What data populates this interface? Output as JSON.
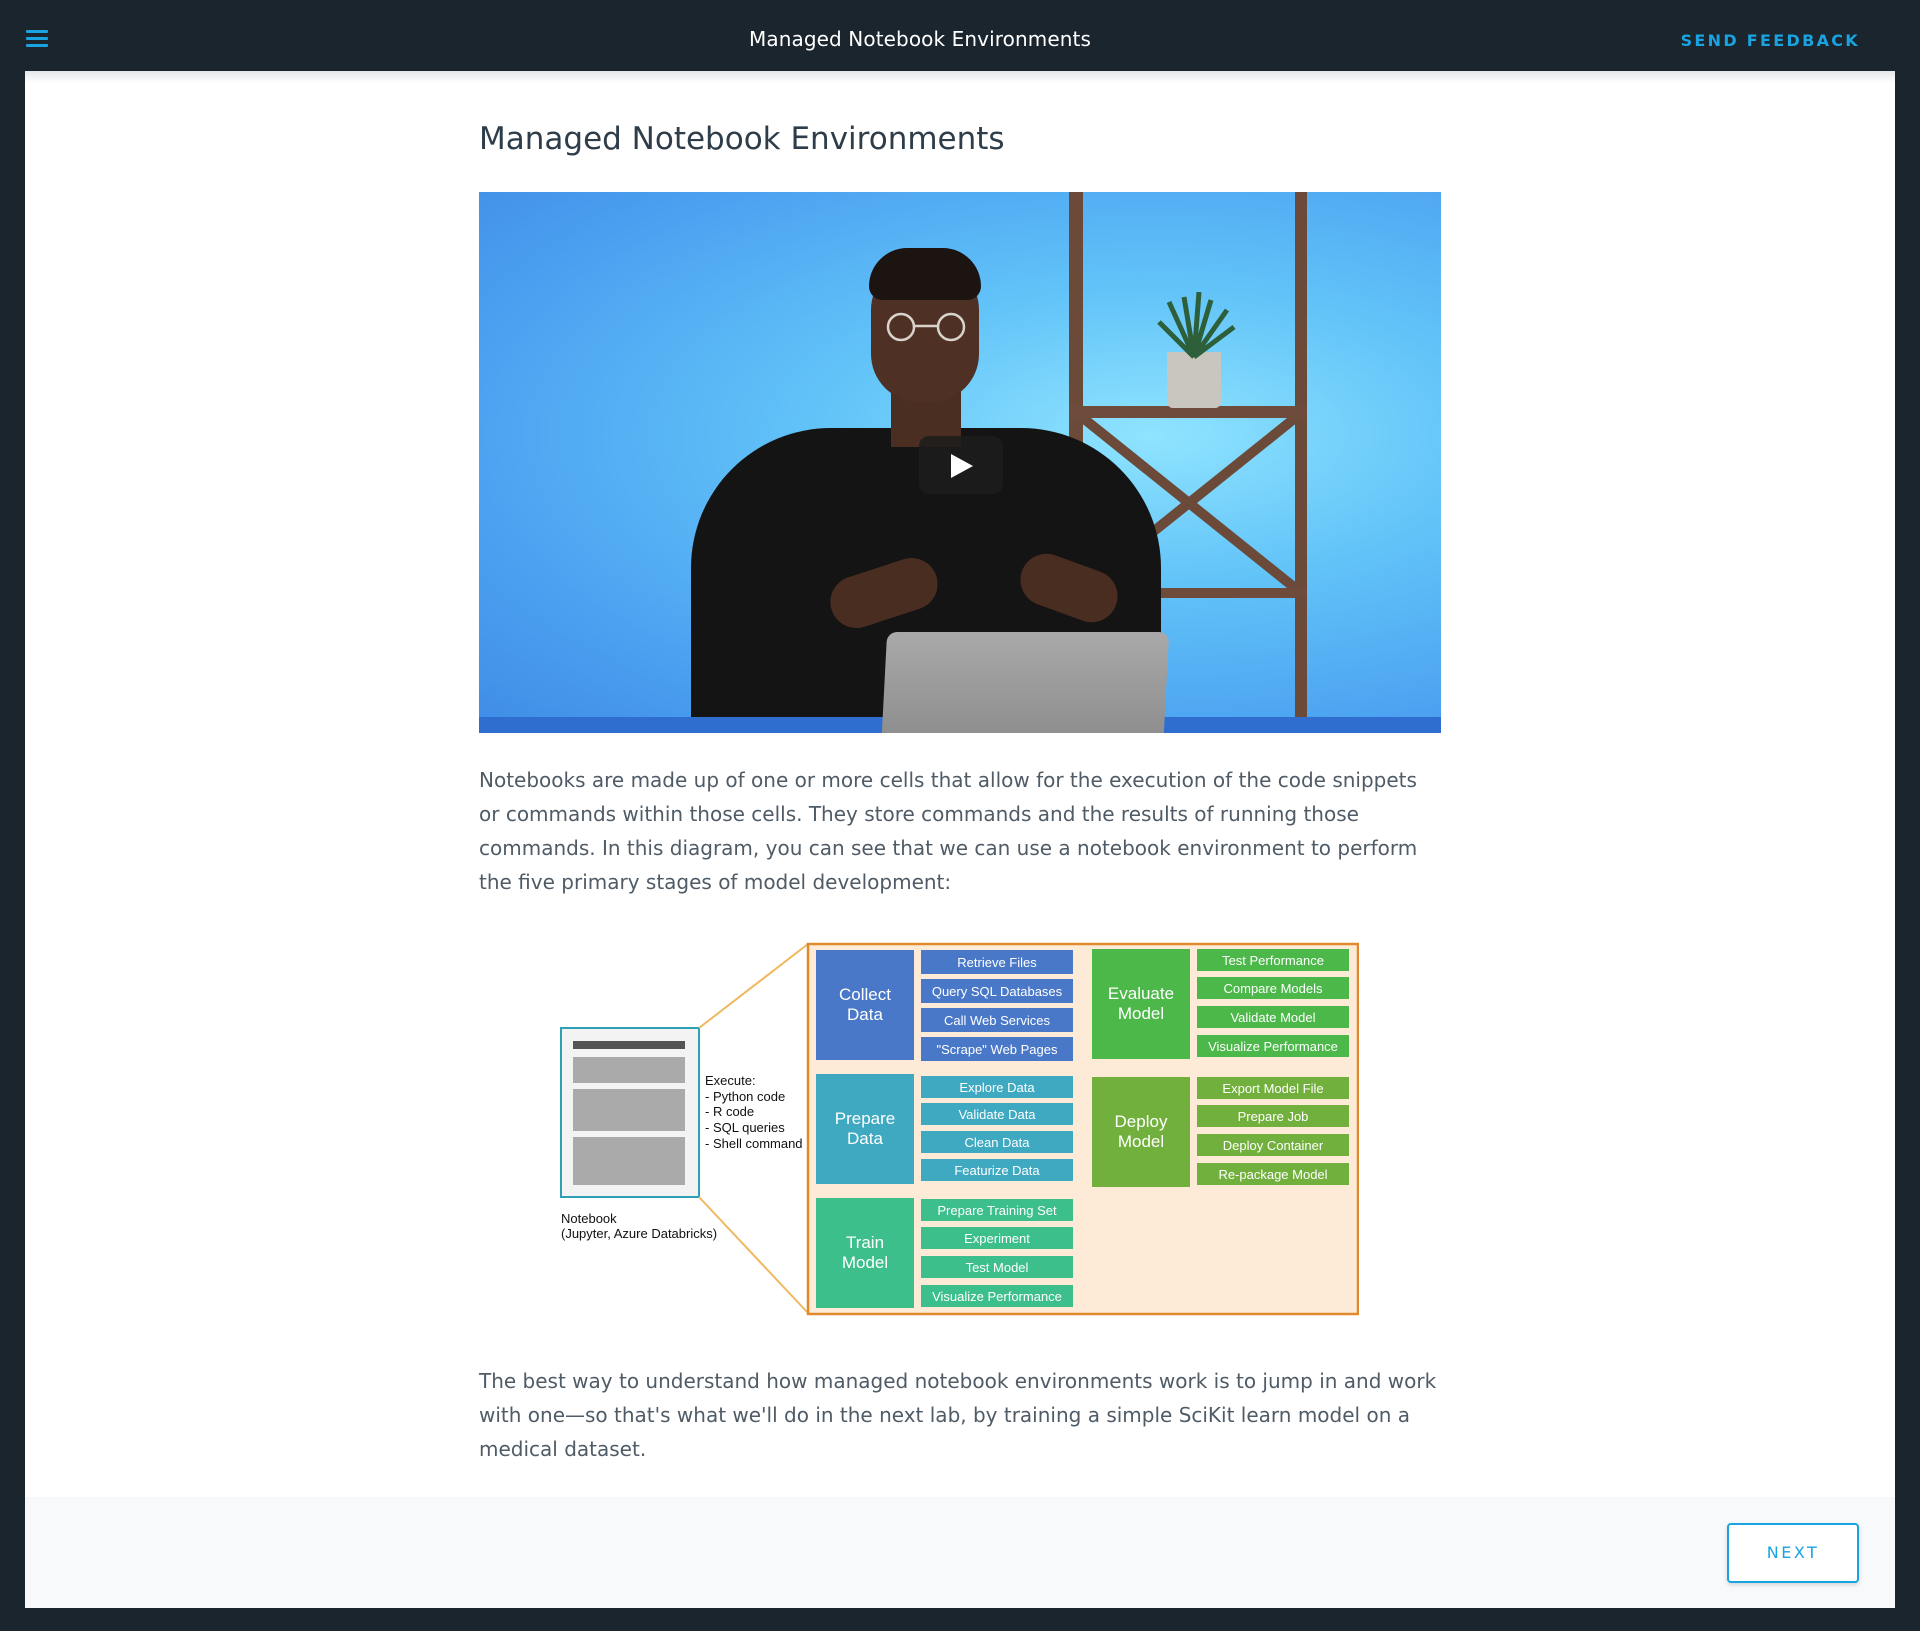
{
  "topbar": {
    "title": "Managed Notebook Environments",
    "feedback_label": "SEND FEEDBACK",
    "menu_icon": "hamburger-menu-icon"
  },
  "main": {
    "title": "Managed Notebook Environments",
    "video": {
      "play_icon": "play-icon"
    },
    "paragraph_1": "Notebooks are made up of one or more cells that allow for the execution of the code snippets or commands within those cells. They store commands and the results of running those commands. In this diagram, you can see that we can use a notebook environment to perform the five primary stages of model development:",
    "paragraph_2": "The best way to understand how managed notebook environments work is to jump in and work with one—so that's what we'll do in the next lab, by training a simple SciKit learn model on a medical dataset."
  },
  "diagram": {
    "notebook_label_1": "Notebook",
    "notebook_label_2": "(Jupyter, Azure Databricks)",
    "execute_title": "Execute:",
    "execute_items": [
      "- Python code",
      "- R code",
      "- SQL queries",
      "- Shell command"
    ],
    "collect": {
      "title_1": "Collect",
      "title_2": "Data",
      "tasks": [
        "Retrieve Files",
        "Query SQL Databases",
        "Call Web Services",
        "\"Scrape\" Web Pages"
      ]
    },
    "prepare": {
      "title_1": "Prepare",
      "title_2": "Data",
      "tasks": [
        "Explore Data",
        "Validate Data",
        "Clean Data",
        "Featurize Data"
      ]
    },
    "train": {
      "title_1": "Train",
      "title_2": "Model",
      "tasks": [
        "Prepare Training Set",
        "Experiment",
        "Test Model",
        "Visualize Performance"
      ]
    },
    "evaluate": {
      "title_1": "Evaluate",
      "title_2": "Model",
      "tasks": [
        "Test Performance",
        "Compare Models",
        "Validate Model",
        "Visualize Performance"
      ]
    },
    "deploy": {
      "title_1": "Deploy",
      "title_2": "Model",
      "tasks": [
        "Export Model File",
        "Prepare Job",
        "Deploy Container",
        "Re-package Model"
      ]
    },
    "colors": {
      "collect": "#4a78c8",
      "prepare": "#3fa9c1",
      "train": "#3dbf8c",
      "evaluate": "#4cb849",
      "deploy": "#72b03e",
      "panel_bg": "#fdebd8",
      "panel_border": "#e08a2c"
    }
  },
  "footer": {
    "next_label": "NEXT"
  },
  "colors": {
    "accent": "#19a3e0",
    "topbar_bg": "#1b252e",
    "title_text": "#2e3d49",
    "body_text": "#4f5b66"
  }
}
